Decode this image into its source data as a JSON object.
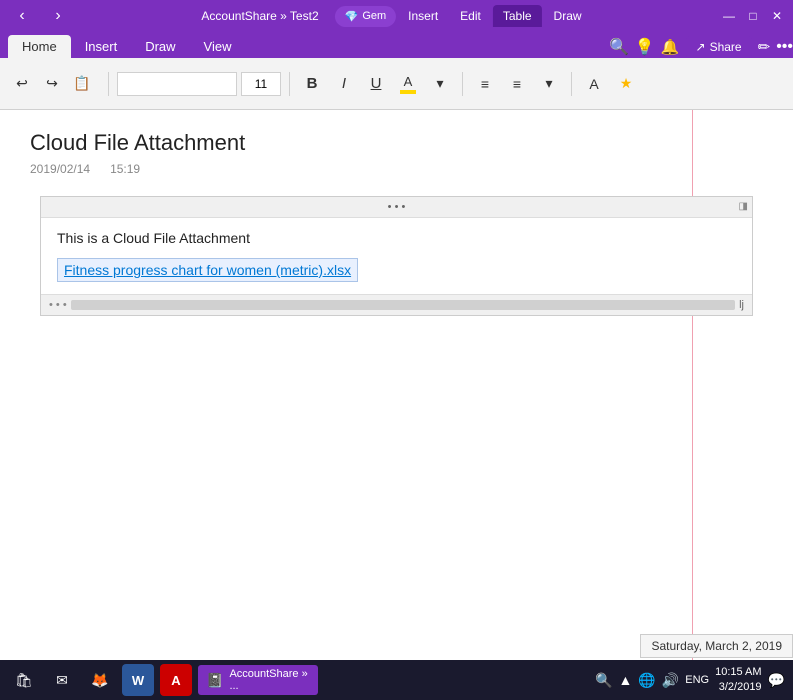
{
  "titleBar": {
    "appTitle": "AccountShare » Test2",
    "tabs": [
      "Gem",
      "Insert",
      "Edit",
      "Table",
      "Draw"
    ],
    "activeTab": "Table",
    "minimizeLabel": "—",
    "maximizeLabel": "□",
    "closeLabel": "✕"
  },
  "ribbonTabs": {
    "items": [
      "Home",
      "Insert",
      "Draw",
      "View"
    ],
    "activeTab": "Home"
  },
  "toolbar": {
    "undoLabel": "↩",
    "redoLabel": "↪",
    "clipboardLabel": "📋",
    "fontName": "",
    "fontSize": "11",
    "boldLabel": "B",
    "italicLabel": "I",
    "underlineLabel": "U",
    "highlightLabel": "A",
    "dropdownLabel": "▾",
    "listLabel": "≡",
    "numberedListLabel": "≡",
    "dropdownLabel2": "▾",
    "highlightALabel": "A",
    "starLabel": "★"
  },
  "note": {
    "title": "Cloud File Attachment",
    "date": "2019/02/14",
    "time": "15:19",
    "blockDots": "• • •",
    "blockResizeIcon": "◨",
    "blockText": "This is a Cloud File Attachment",
    "fileLink": "Fitness progress chart for women (metric).xlsx",
    "footerDots": "• • •",
    "footerLetter": "lj"
  },
  "taskbar": {
    "storeIcon": "🛍",
    "mailIcon": "✉",
    "firefoxIcon": "🦊",
    "wordIcon": "W",
    "adobeIcon": "A",
    "oneNoteLabel": "AccountShare » ...",
    "searchIcon": "🔍",
    "upArrow": "▲",
    "networkIcon": "🌐",
    "speakerIcon": "🔊",
    "engLabel": "ENG",
    "notifIcon": "🔔",
    "time": "10:15 AM",
    "date": "3/2/2019",
    "tooltip": "Saturday, March 2, 2019"
  },
  "colors": {
    "purple": "#7B2FBE",
    "darkPurple": "#5a1a9a",
    "accent": "#0078d4",
    "linkBg": "#e8f0fe"
  }
}
